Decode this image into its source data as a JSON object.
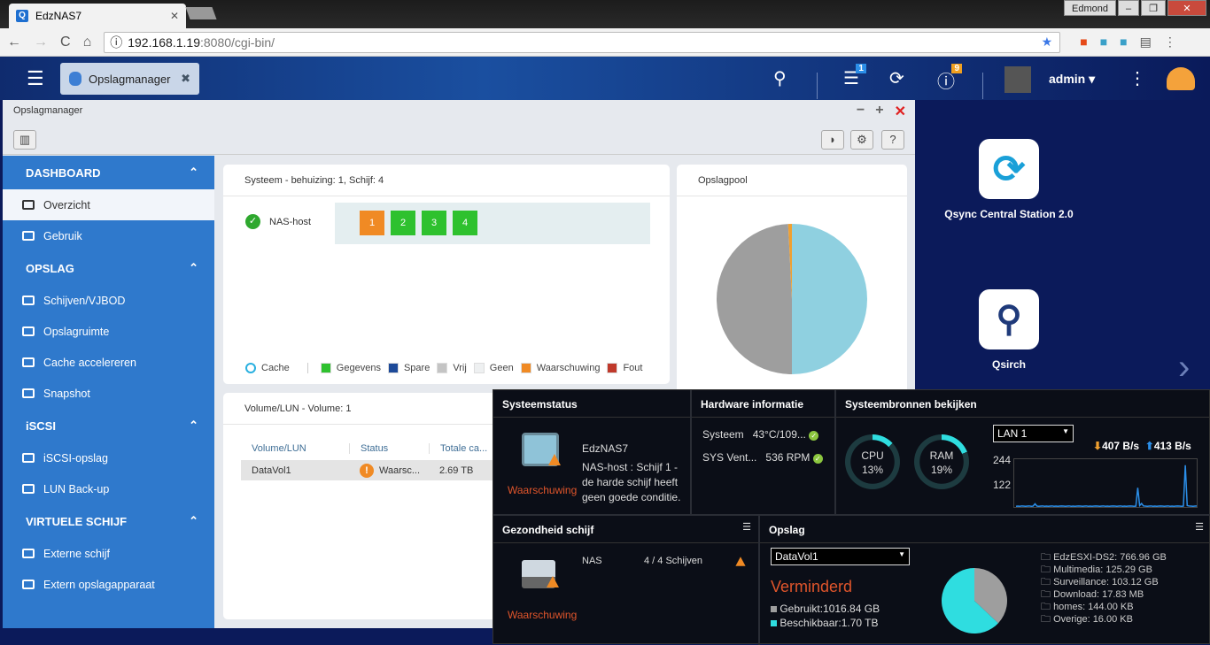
{
  "browser": {
    "tab_title": "EdzNAS7",
    "url_host": "192.168.1.19",
    "url_rest": ":8080/cgi-bin/",
    "profile": "Edmond"
  },
  "qts": {
    "app_tab": "Opslagmanager",
    "tasks_badge": "1",
    "info_badge": "9",
    "user": "admin"
  },
  "window": {
    "title": "Opslagmanager"
  },
  "sidebar": {
    "sections": [
      {
        "label": "DASHBOARD",
        "items": [
          {
            "label": "Overzicht"
          },
          {
            "label": "Gebruik"
          }
        ]
      },
      {
        "label": "OPSLAG",
        "items": [
          {
            "label": "Schijven/VJBOD"
          },
          {
            "label": "Opslagruimte"
          },
          {
            "label": "Cache accelereren"
          },
          {
            "label": "Snapshot"
          }
        ]
      },
      {
        "label": "iSCSI",
        "items": [
          {
            "label": "iSCSI-opslag"
          },
          {
            "label": "LUN Back-up"
          }
        ]
      },
      {
        "label": "VIRTUELE SCHIJF",
        "items": [
          {
            "label": "Externe schijf"
          },
          {
            "label": "Extern opslagapparaat"
          }
        ]
      }
    ]
  },
  "system_panel": {
    "title": "Systeem - behuizing: 1, Schijf: 4",
    "host": "NAS-host",
    "disks": [
      {
        "n": "1",
        "color": "#f08a24"
      },
      {
        "n": "2",
        "color": "#2ec12e"
      },
      {
        "n": "3",
        "color": "#2ec12e"
      },
      {
        "n": "4",
        "color": "#2ec12e"
      }
    ],
    "legend": {
      "cache": "Cache",
      "items": [
        {
          "label": "Gegevens",
          "color": "#2ec12e"
        },
        {
          "label": "Spare",
          "color": "#1d4a99"
        },
        {
          "label": "Vrij",
          "color": "#c4c4c4"
        },
        {
          "label": "Geen",
          "color": "#eef0f1"
        },
        {
          "label": "Waarschuwing",
          "color": "#f08a24"
        },
        {
          "label": "Fout",
          "color": "#c0392b"
        }
      ]
    }
  },
  "pool_panel": {
    "title": "Opslagpool",
    "slices": [
      {
        "fraction": 0.5,
        "color": "#8fd0e0"
      },
      {
        "fraction": 0.492,
        "color": "#9e9e9e"
      },
      {
        "fraction": 0.008,
        "color": "#f0a030"
      }
    ]
  },
  "volume_panel": {
    "title": "Volume/LUN - Volume: 1",
    "columns": [
      "Volume/LUN",
      "Status",
      "Totale ca..."
    ],
    "rows": [
      {
        "name": "DataVol1",
        "status": "Waarsc...",
        "total": "2.69 TB"
      }
    ]
  },
  "desktop": {
    "apps": [
      {
        "label": "Qsync Central Station 2.0"
      },
      {
        "label": "Qsirch"
      }
    ]
  },
  "widgets": {
    "status": {
      "title": "Systeemstatus",
      "name": "EdzNAS7",
      "message": "NAS-host : Schijf 1 - de harde schijf heeft geen goede conditie.",
      "state": "Waarschuwing"
    },
    "hardware": {
      "title": "Hardware informatie",
      "rows": [
        {
          "label": "Systeem",
          "value": "43°C/109..."
        },
        {
          "label": "SYS Vent...",
          "value": "536 RPM"
        }
      ]
    },
    "resources": {
      "title": "Systeembronnen bekijken",
      "cpu_label": "CPU",
      "cpu": "13%",
      "cpu_value": 13,
      "ram_label": "RAM",
      "ram": "19%",
      "ram_value": 19,
      "lan": "LAN 1",
      "down": "407 B/s",
      "up": "413 B/s",
      "y_ticks": [
        "244",
        "122"
      ],
      "traffic": [
        4,
        5,
        4,
        6,
        5,
        4,
        5,
        6,
        4,
        5,
        18,
        5,
        4,
        5,
        6,
        4,
        5,
        4,
        5,
        6,
        4,
        5,
        4,
        5,
        6,
        5,
        4,
        5,
        6,
        4,
        5,
        4,
        5,
        6,
        5,
        4,
        5,
        6,
        4,
        5,
        4,
        5,
        6,
        5,
        4,
        5,
        6,
        4,
        5,
        4,
        5,
        6,
        5,
        4,
        5,
        6,
        4,
        5,
        4,
        5,
        6,
        5,
        4,
        5,
        110,
        8,
        20,
        6,
        5,
        4,
        5,
        6,
        4,
        5,
        4,
        5,
        6,
        5,
        4,
        5,
        6,
        4,
        5,
        4,
        5,
        6,
        5,
        4,
        5,
        240,
        8,
        6,
        5,
        4,
        5,
        6
      ]
    },
    "disk_health": {
      "title": "Gezondheid schijf",
      "host": "NAS",
      "count": "4 / 4 Schijven",
      "state": "Waarschuwing"
    },
    "storage": {
      "title": "Opslag",
      "volume": "DataVol1",
      "state": "Verminderd",
      "used": "Gebruikt:1016.84 GB",
      "available": "Beschikbaar:1.70 TB",
      "used_fraction": 0.37,
      "used_color": "#9e9e9e",
      "available_color": "#2fdde0",
      "folders": [
        "EdzESXI-DS2: 766.96 GB",
        "Multimedia: 125.29 GB",
        "Surveillance: 103.12 GB",
        "Download: 17.83 MB",
        "homes: 144.00 KB",
        "Overige: 16.00 KB"
      ]
    }
  }
}
